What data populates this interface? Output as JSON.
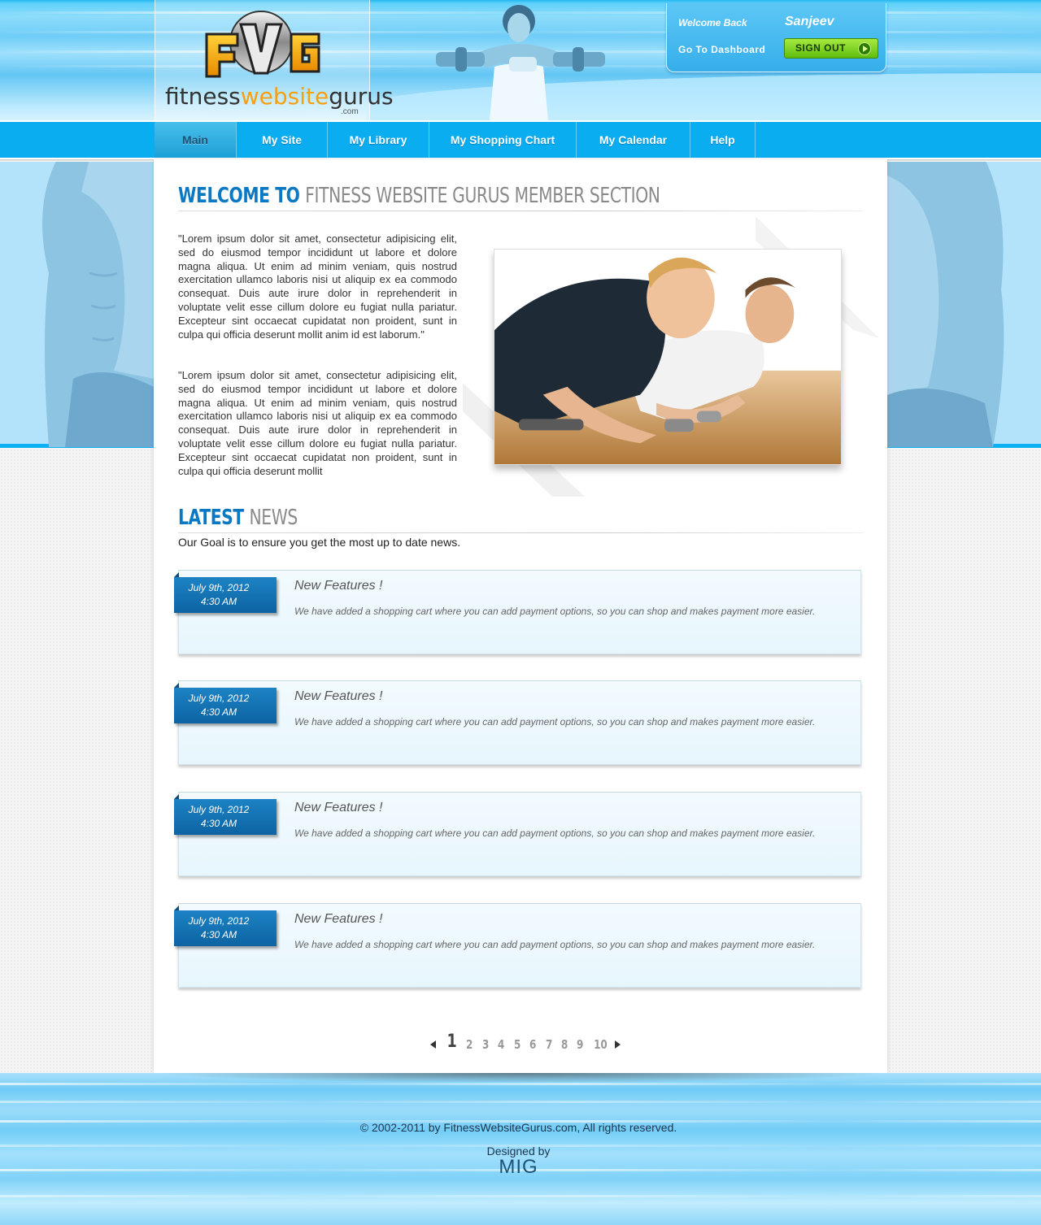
{
  "header": {
    "logo_letters": "FWG",
    "logo_text_part1": "fitness",
    "logo_text_part2": "website",
    "logo_text_part3": "gurus",
    "logo_com": ".com",
    "welcome_label": "Welcome Back",
    "username": "Sanjeev",
    "dashboard_link": "Go  To  Dashboard",
    "signout_label": "SIGN OUT"
  },
  "nav": {
    "items": [
      {
        "label": "Main",
        "active": true
      },
      {
        "label": "My Site",
        "active": false
      },
      {
        "label": "My Library",
        "active": false
      },
      {
        "label": "My Shopping Chart",
        "active": false
      },
      {
        "label": "My Calendar",
        "active": false
      },
      {
        "label": "Help",
        "active": false
      }
    ]
  },
  "welcome": {
    "title_blue": "WELCOME TO",
    "title_gray": "FITNESS WEBSITE GURUS MEMBER SECTION",
    "paragraph1": "\"Lorem ipsum dolor sit amet, consectetur adipisicing elit, sed do eiusmod tempor incididunt ut labore et dolore magna aliqua. Ut enim ad minim veniam, quis nostrud exercitation ullamco laboris nisi ut aliquip ex ea commodo consequat. Duis aute irure dolor in reprehenderit in voluptate velit esse cillum dolore eu fugiat nulla pariatur. Excepteur sint occaecat cupidatat non proident, sunt in culpa qui officia deserunt mollit anim id est laborum.\"",
    "paragraph2": "\"Lorem ipsum dolor sit amet, consectetur adipisicing elit, sed do eiusmod tempor incididunt ut labore et dolore magna aliqua. Ut enim ad minim veniam, quis nostrud exercitation ullamco laboris nisi ut aliquip ex ea commodo consequat. Duis aute irure dolor in reprehenderit in voluptate velit esse cillum dolore eu fugiat nulla pariatur. Excepteur sint occaecat cupidatat non proident, sunt in culpa qui officia deserunt mollit"
  },
  "news": {
    "title_blue": "LATEST",
    "title_gray": "NEWS",
    "subtitle": "Our Goal is to ensure you get the most up to date news.",
    "items": [
      {
        "date": "July 9th, 2012",
        "time": "4:30 AM",
        "title": "New Features !",
        "text": "We have added a shopping cart where you can add payment options, so you can shop and makes payment more easier."
      },
      {
        "date": "July 9th, 2012",
        "time": "4:30 AM",
        "title": "New Features !",
        "text": "We have added a shopping cart where you can add payment options, so you can shop and makes payment more easier."
      },
      {
        "date": "July 9th, 2012",
        "time": "4:30  AM",
        "title": "New Features !",
        "text": "We have added a shopping cart where you can add payment options, so you can shop and makes payment more easier."
      },
      {
        "date": "July 9th, 2012",
        "time": "4:30 AM",
        "title": "New Features !",
        "text": "We have added a shopping cart where you can add payment options, so you can shop and makes payment more easier."
      }
    ]
  },
  "pagination": {
    "pages": [
      "1",
      "2",
      "3",
      "4",
      "5",
      "6",
      "7",
      "8",
      "9",
      "10"
    ],
    "current": "1"
  },
  "footer": {
    "copyright": "© 2002-2011 by FitnessWebsiteGurus.com, All rights reserved.",
    "designed_by": "Designed by",
    "designer": "MIG"
  },
  "colors": {
    "brand_blue": "#0aaef0",
    "title_blue": "#0a78c2",
    "news_date_blue": "#0d63a3",
    "signout_green": "#5fbd0f",
    "logo_orange": "#f4a10f"
  }
}
